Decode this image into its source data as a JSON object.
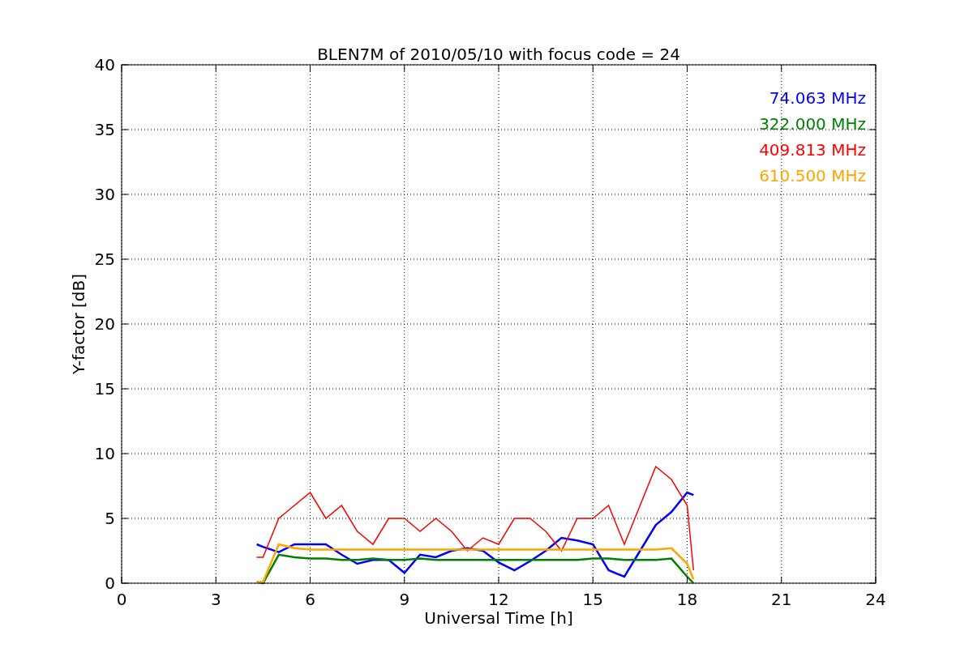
{
  "chart_data": {
    "type": "line",
    "title": "BLEN7M of 2010/05/10 with focus code = 24",
    "xlabel": "Universal Time [h]",
    "ylabel": "Y-factor [dB]",
    "x": [
      4.3,
      4.5,
      5,
      5.5,
      6,
      6.5,
      7,
      7.5,
      8,
      8.5,
      9,
      9.5,
      10,
      10.5,
      11,
      11.5,
      12,
      12.5,
      13,
      13.5,
      14,
      14.5,
      15,
      15.5,
      16,
      16.5,
      17,
      17.5,
      18,
      18.2
    ],
    "series": [
      {
        "name": "74.063 MHz",
        "color": "#0000ff",
        "values": [
          3,
          2.8,
          2.4,
          3,
          3,
          3,
          2.2,
          1.5,
          1.8,
          1.8,
          0.8,
          2.2,
          2,
          2.5,
          2.7,
          2.5,
          1.6,
          1,
          1.7,
          2.5,
          3.5,
          3.3,
          3,
          1,
          0.5,
          2.5,
          4.5,
          5.5,
          7,
          6.8
        ]
      },
      {
        "name": "322.000 MHz",
        "color": "#008000",
        "values": [
          0.1,
          0,
          2.2,
          2,
          1.9,
          1.9,
          1.8,
          1.8,
          1.9,
          1.8,
          1.8,
          1.9,
          1.8,
          1.8,
          1.8,
          1.8,
          1.8,
          1.8,
          1.8,
          1.8,
          1.8,
          1.8,
          1.9,
          1.9,
          1.8,
          1.8,
          1.8,
          1.9,
          0.5,
          0
        ]
      },
      {
        "name": "409.813 MHz",
        "color": "#ff0000",
        "values": [
          2,
          2,
          5,
          6,
          7,
          5,
          6,
          4,
          3,
          5,
          5,
          4,
          5,
          4,
          2.5,
          3.5,
          3,
          5,
          5,
          4,
          2.5,
          5,
          5,
          6,
          3,
          6,
          9,
          8,
          6,
          1
        ]
      },
      {
        "name": "610.500 MHz",
        "color": "#ffa500",
        "values": [
          0.1,
          0.1,
          3,
          2.7,
          2.6,
          2.6,
          2.6,
          2.6,
          2.6,
          2.6,
          2.6,
          2.6,
          2.6,
          2.6,
          2.6,
          2.6,
          2.6,
          2.6,
          2.6,
          2.6,
          2.6,
          2.6,
          2.6,
          2.6,
          2.6,
          2.6,
          2.6,
          2.7,
          1.5,
          0.3
        ]
      }
    ],
    "xlim": [
      0,
      24
    ],
    "ylim": [
      0,
      40
    ],
    "xticks": [
      0,
      3,
      6,
      9,
      12,
      15,
      18,
      21,
      24
    ],
    "yticks": [
      0,
      5,
      10,
      15,
      20,
      25,
      30,
      35,
      40
    ],
    "grid": true
  }
}
